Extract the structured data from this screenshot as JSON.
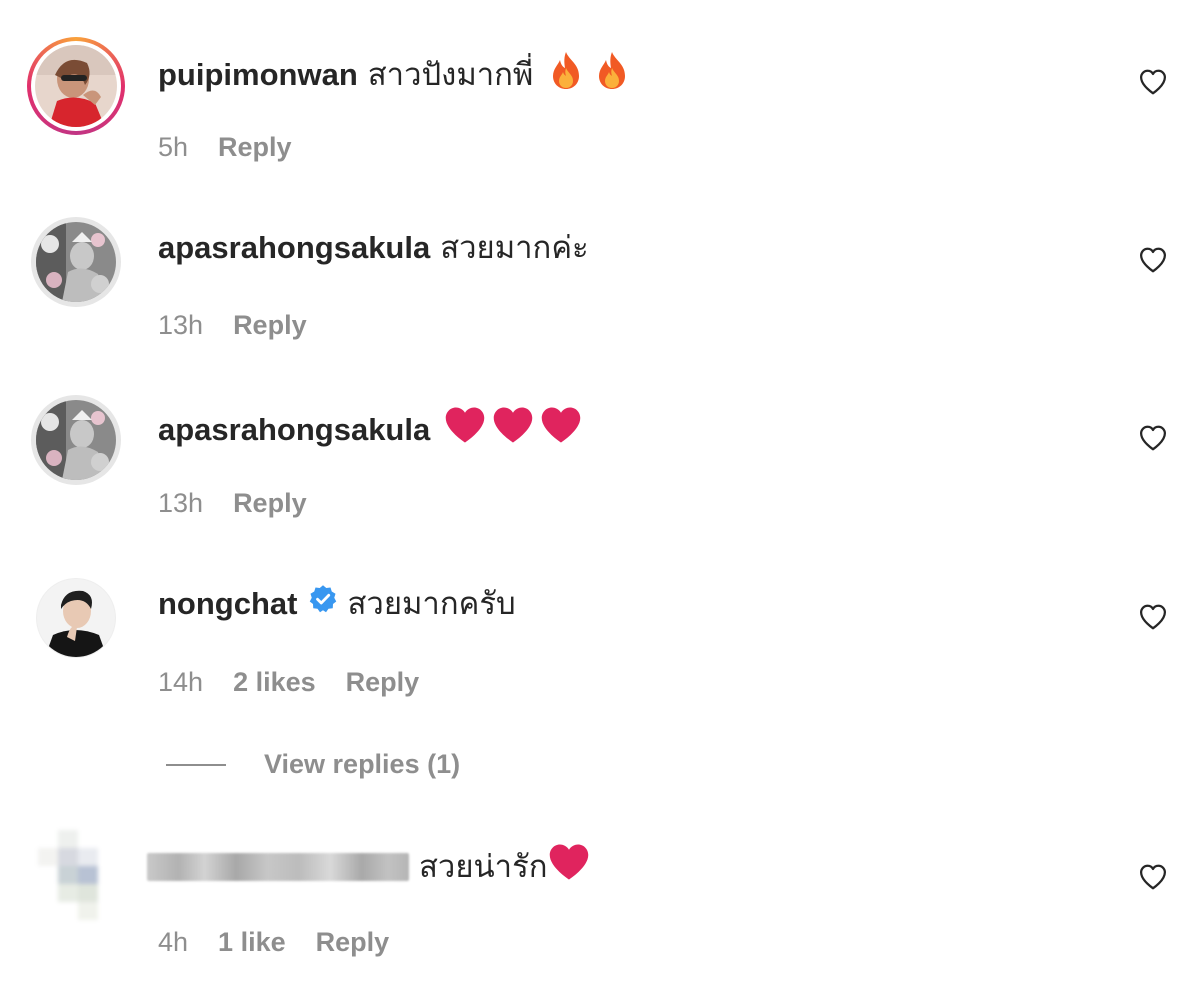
{
  "comments": [
    {
      "username": "puipimonwan",
      "text": "สาวปังมากพี่",
      "emoji": "fire-icon x2",
      "time": "5h",
      "reply_label": "Reply"
    },
    {
      "username": "apasrahongsakula",
      "text": "สวยมากค่ะ",
      "time": "13h",
      "reply_label": "Reply"
    },
    {
      "username": "apasrahongsakula",
      "text": "",
      "emoji": "red-heart-icon x3",
      "time": "13h",
      "reply_label": "Reply"
    },
    {
      "username": "nongchat",
      "verified": true,
      "text": "สวยมากครับ",
      "time": "14h",
      "likes": "2 likes",
      "reply_label": "Reply",
      "view_replies": "View replies (1)"
    },
    {
      "username": "",
      "text": "สวยน่ารัก",
      "emoji": "red-heart-icon",
      "time": "4h",
      "likes": "1 like",
      "reply_label": "Reply"
    }
  ],
  "colors": {
    "text": "#262626",
    "meta": "#8e8e8e",
    "verified": "#3897f0",
    "heart_emoji": "#e0245e"
  },
  "icons": {
    "like": "heart-outline-icon",
    "verified": "verified-badge-icon"
  }
}
